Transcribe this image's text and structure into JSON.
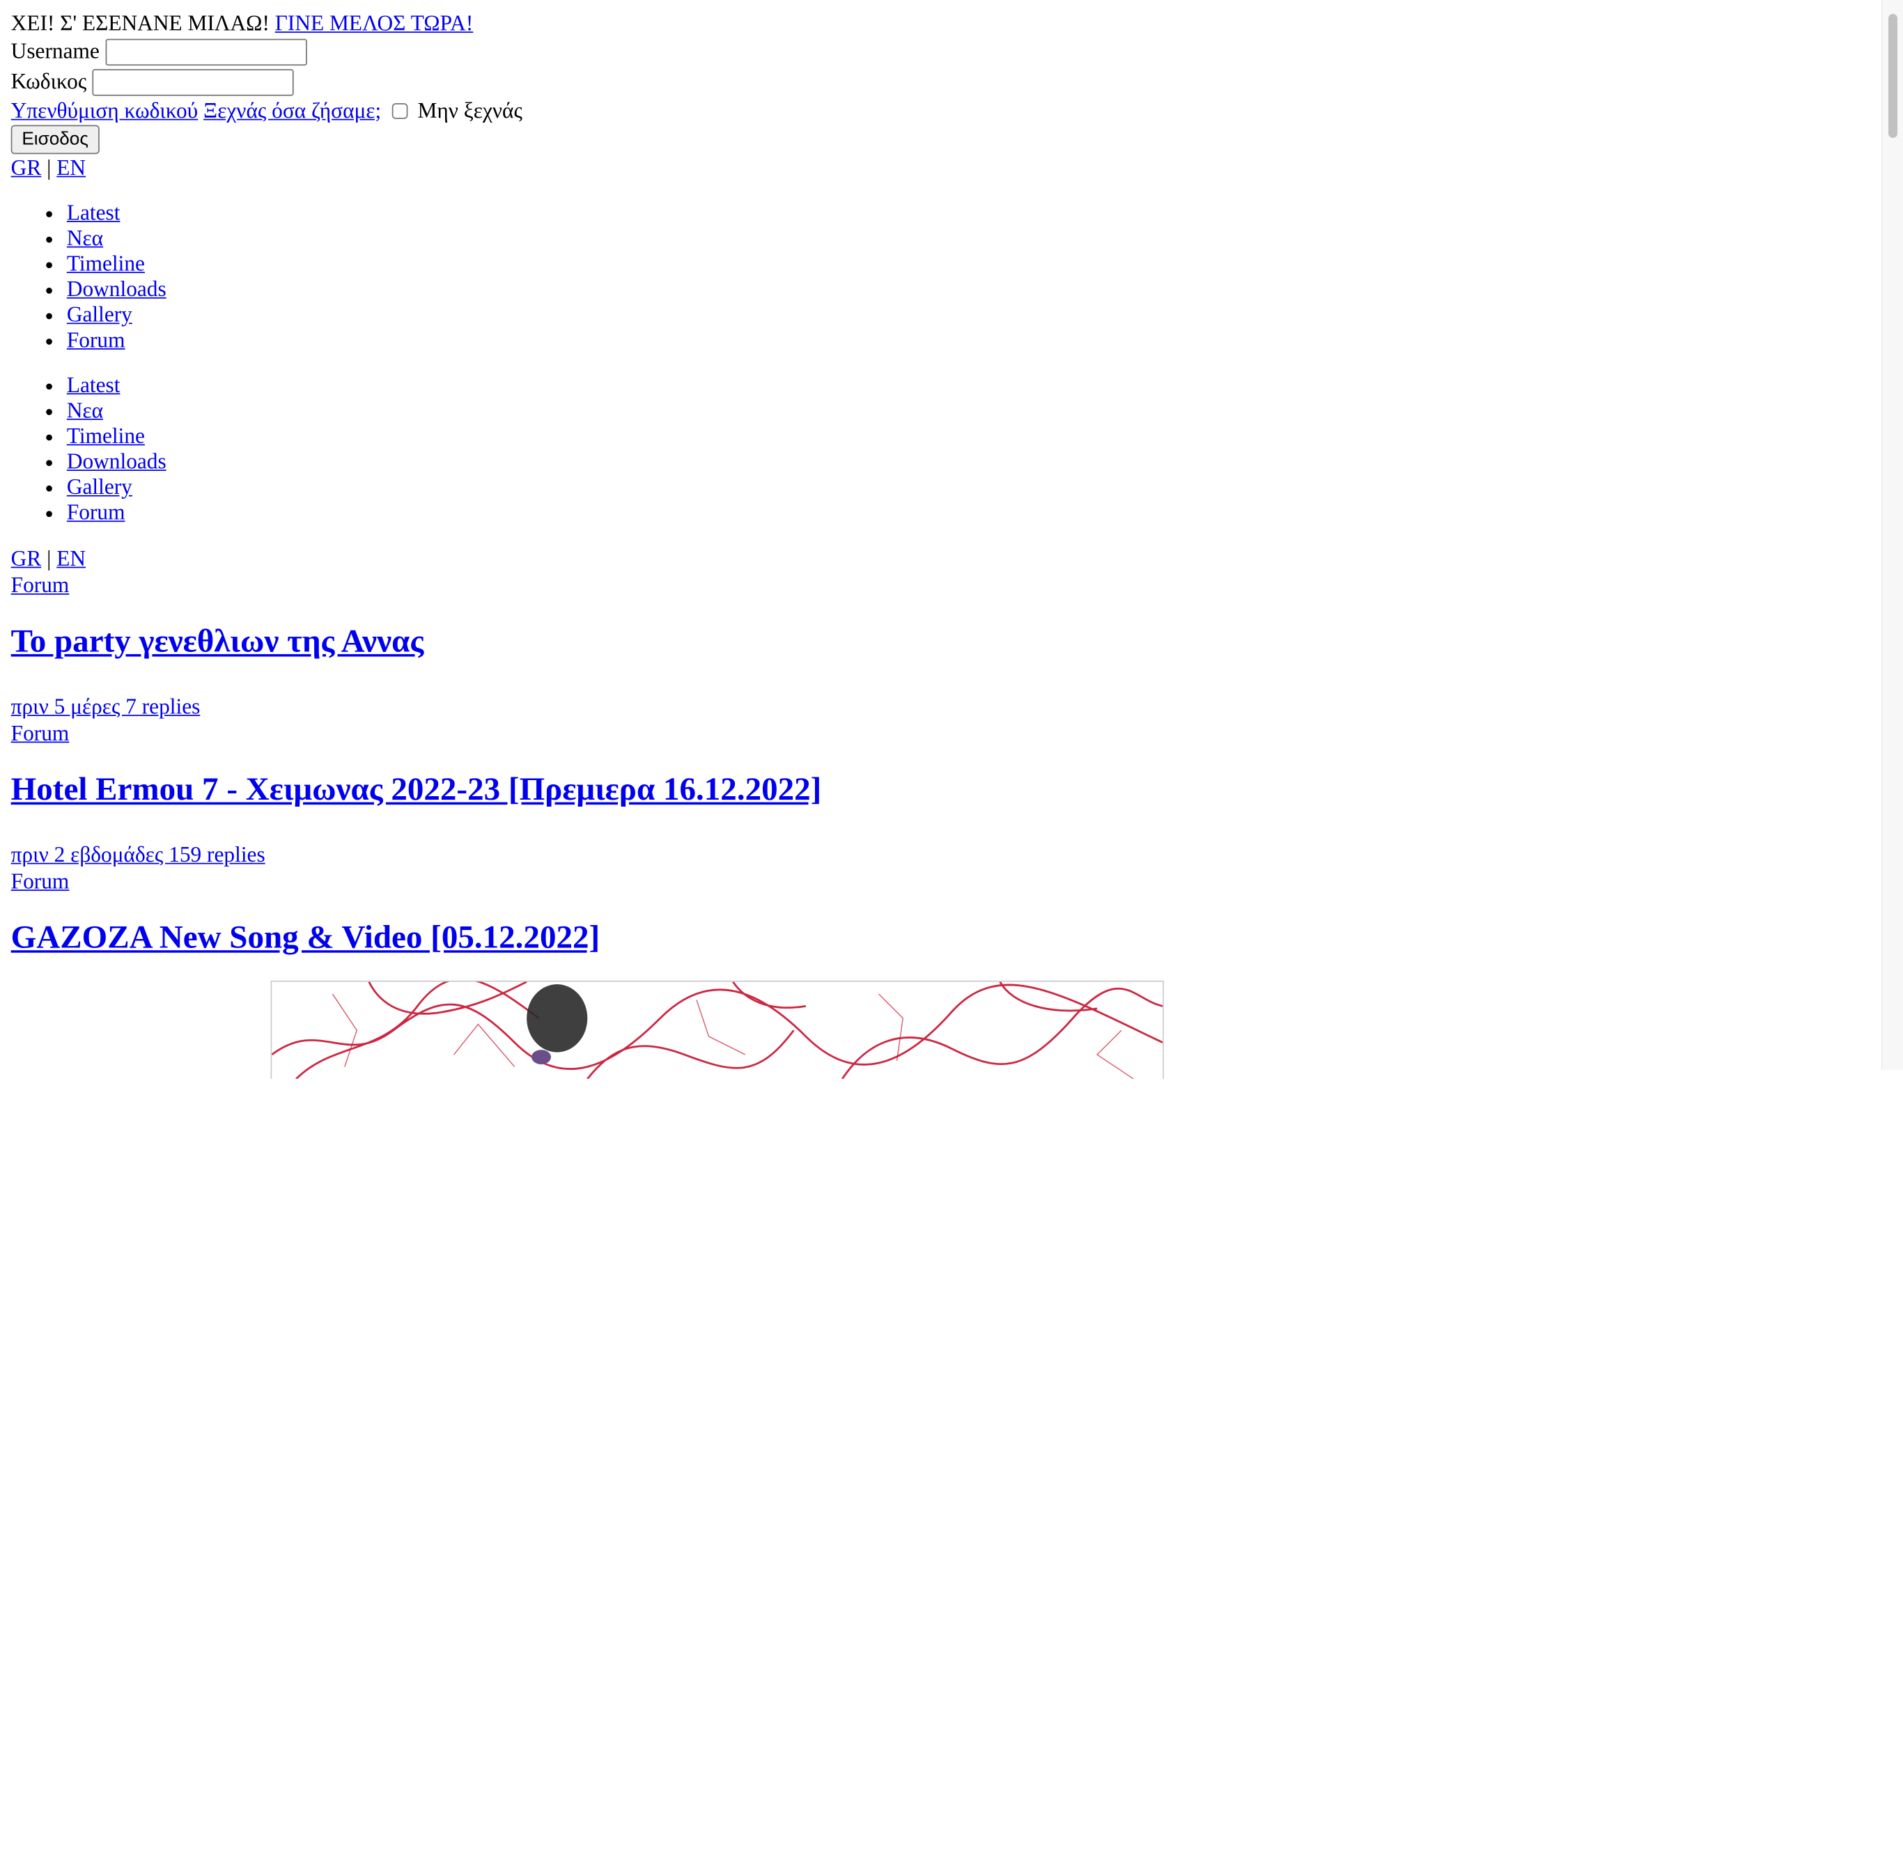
{
  "header": {
    "greeting": "ΧΕΙ! Σ' ΕΣΕΝΑΝΕ ΜΙΛΑΩ!",
    "join_link": "ΓΙΝΕ ΜΕΛΟΣ ΤΩΡΑ!"
  },
  "login": {
    "username_label": "Username",
    "username_value": "",
    "password_label": "Κωδικος",
    "password_value": "",
    "remind_link": "Υπενθύμιση κωδικού",
    "forgot_link": "Ξεχνάς όσα ζήσαμε;",
    "remember_label": "Μην ξεχνάς",
    "remember_checked": false,
    "submit_label": "Εισοδος"
  },
  "lang": {
    "gr": "GR",
    "sep": "|",
    "en": "EN"
  },
  "nav": [
    "Latest",
    "Νεα",
    "Timeline",
    "Downloads",
    "Gallery",
    "Forum"
  ],
  "posts": [
    {
      "category": "Forum",
      "title": "To party γενεθλιων της Αννας",
      "meta": "πριν 5 μέρες 7 replies"
    },
    {
      "category": "Forum",
      "title": "Hotel Ermou 7 - Χειμωνας 2022-23 [Πρεμιερα 16.12.2022]",
      "meta": "πριν 2 εβδομάδες 159 replies"
    },
    {
      "category": "Forum",
      "title": "GAZOZA New Song & Video [05.12.2022]",
      "meta": ""
    }
  ],
  "colors": {
    "link": "#0000ee",
    "image_red": "#c8102e"
  }
}
